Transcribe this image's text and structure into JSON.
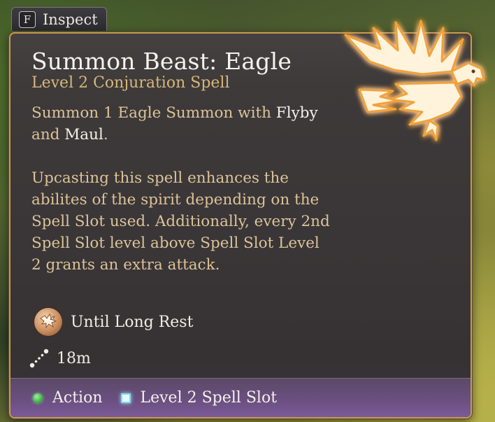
{
  "inspect": {
    "key": "F",
    "label": "Inspect"
  },
  "spell": {
    "title": "Summon Beast: Eagle",
    "subtitle": "Level 2 Conjuration Spell",
    "description": {
      "p1_a": "Summon 1 Eagle Summon with ",
      "p1_flyby": "Flyby",
      "p1_and": " and ",
      "p1_maul": "Maul",
      "p1_end": ".",
      "p2": "Upcasting this spell enhances the abilites of the spirit depending on the Spell Slot used. Additionally, every 2nd Spell Slot level above Spell Slot Level 2 grants an extra attack."
    },
    "duration": "Until Long Rest",
    "range": "18m",
    "cost": {
      "action": "Action",
      "slot": "Level 2 Spell Slot"
    }
  },
  "icons": {
    "emblem": "eagle-icon",
    "duration": "eagle-summon-icon",
    "range": "range-dots-icon",
    "action": "action-dot-icon",
    "slot": "spell-slot-icon"
  },
  "colors": {
    "border_gold": "#c79b4d",
    "title": "#f6f1ea",
    "subtitle": "#d6b77a",
    "description": "#dcc398",
    "highlight": "#f4efe7",
    "cost_bar": "#6a4f80",
    "action_green": "#4fbf58",
    "slot_cyan": "#9ae8ff"
  }
}
